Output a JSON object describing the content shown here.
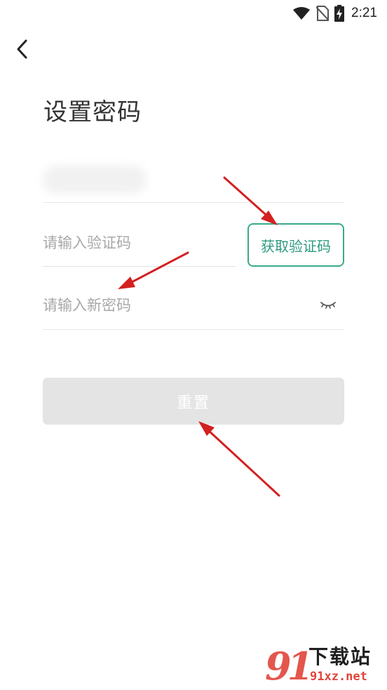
{
  "status_bar": {
    "time": "2:21",
    "icons": [
      "wifi-icon",
      "no-sim-icon",
      "battery-charging-icon"
    ]
  },
  "nav": {
    "back_icon": "chevron-left-icon"
  },
  "page": {
    "title": "设置密码"
  },
  "form": {
    "phone_value": "",
    "code_placeholder": "请输入验证码",
    "code_value": "",
    "get_code_label": "获取验证码",
    "password_placeholder": "请输入新密码",
    "password_value": "",
    "eye_icon": "eye-closed-icon",
    "reset_label": "重置"
  },
  "colors": {
    "accent": "#3aa98d",
    "reset_disabled_bg": "#e4e4e4",
    "annotation_arrow": "#d32020"
  },
  "watermark": {
    "digits": "91",
    "brand": "下载站",
    "domain": "91xz.net"
  }
}
